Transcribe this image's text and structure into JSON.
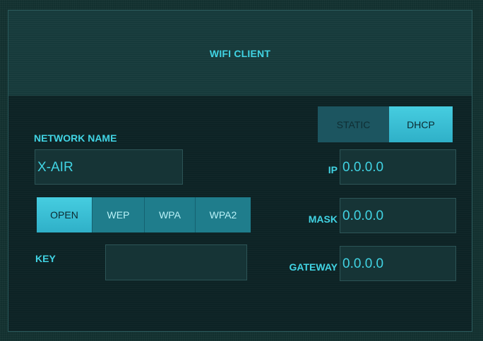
{
  "title": "WIFI CLIENT",
  "network": {
    "label": "NETWORK NAME",
    "value": "X-AIR"
  },
  "security": {
    "options": [
      "OPEN",
      "WEP",
      "WPA",
      "WPA2"
    ],
    "selected": "OPEN"
  },
  "key": {
    "label": "KEY",
    "value": ""
  },
  "mode": {
    "options": [
      "STATIC",
      "DHCP"
    ],
    "selected": "DHCP"
  },
  "ip": {
    "label": "IP",
    "value": "0.0.0.0"
  },
  "mask": {
    "label": "MASK",
    "value": "0.0.0.0"
  },
  "gateway": {
    "label": "GATEWAY",
    "value": "0.0.0.0"
  },
  "colors": {
    "accent": "#41d4e4",
    "background": "#0d2325",
    "active_button": "#3cc2d8"
  }
}
